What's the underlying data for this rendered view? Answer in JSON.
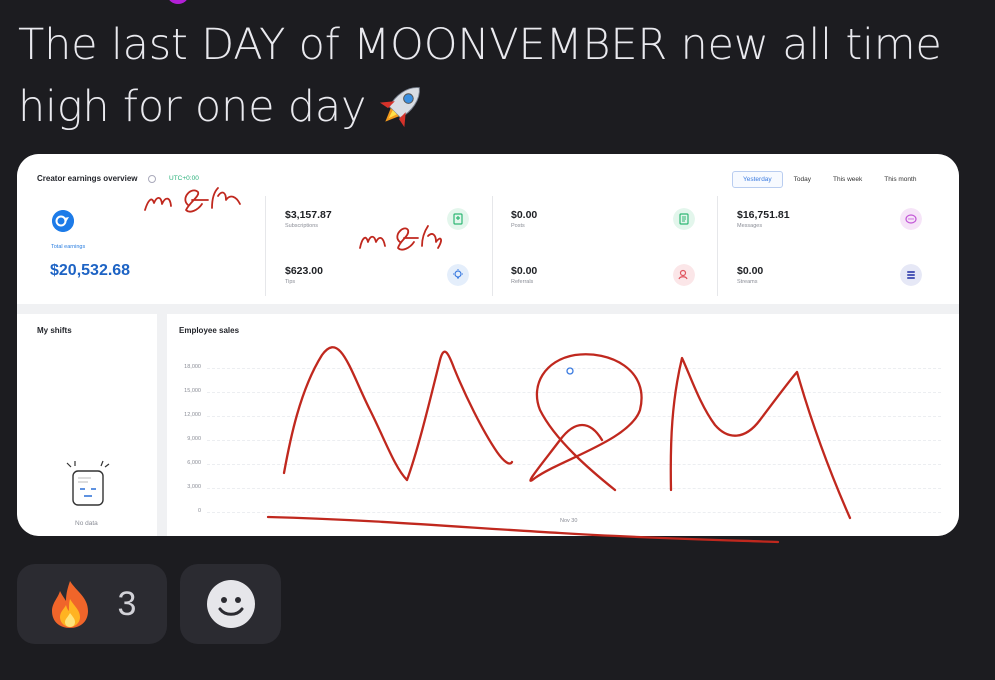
{
  "post": {
    "caption_line1": "The last DAY of MOONVEMBER new all time",
    "caption_line2": "high for one day",
    "caption_emoji": "rocket"
  },
  "dashboard": {
    "title": "Creator earnings overview",
    "timezone": "UTC+0:00",
    "tabs": [
      "Yesterday",
      "Today",
      "This week",
      "This month"
    ],
    "active_tab": "Yesterday",
    "total_label": "Total earnings",
    "total_value": "$20,532.68",
    "metrics": [
      {
        "value": "$3,157.87",
        "label": "Subscriptions",
        "icon": "subscriptions-icon",
        "color": "#2fb874"
      },
      {
        "value": "$0.00",
        "label": "Posts",
        "icon": "posts-icon",
        "color": "#2fb874"
      },
      {
        "value": "$16,751.81",
        "label": "Messages",
        "icon": "messages-icon",
        "color": "#c257d6"
      },
      {
        "value": "$623.00",
        "label": "Tips",
        "icon": "tips-icon",
        "color": "#3b7be0"
      },
      {
        "value": "$0.00",
        "label": "Referrals",
        "icon": "referrals-icon",
        "color": "#e0555f"
      },
      {
        "value": "$0.00",
        "label": "Streams",
        "icon": "streams-icon",
        "color": "#4f5ab8"
      }
    ],
    "shifts": {
      "title": "My shifts",
      "empty_text": "No data"
    },
    "sales": {
      "title": "Employee sales",
      "y_ticks": [
        "18,000",
        "15,000",
        "12,000",
        "9,000",
        "6,000",
        "3,000",
        "0"
      ],
      "x_tick": "Nov 30"
    },
    "annotation_color": "#c0281e"
  },
  "reactions": {
    "fire_count": "3",
    "fire_emoji": "fire",
    "add_icon": "smiley-add-icon"
  }
}
